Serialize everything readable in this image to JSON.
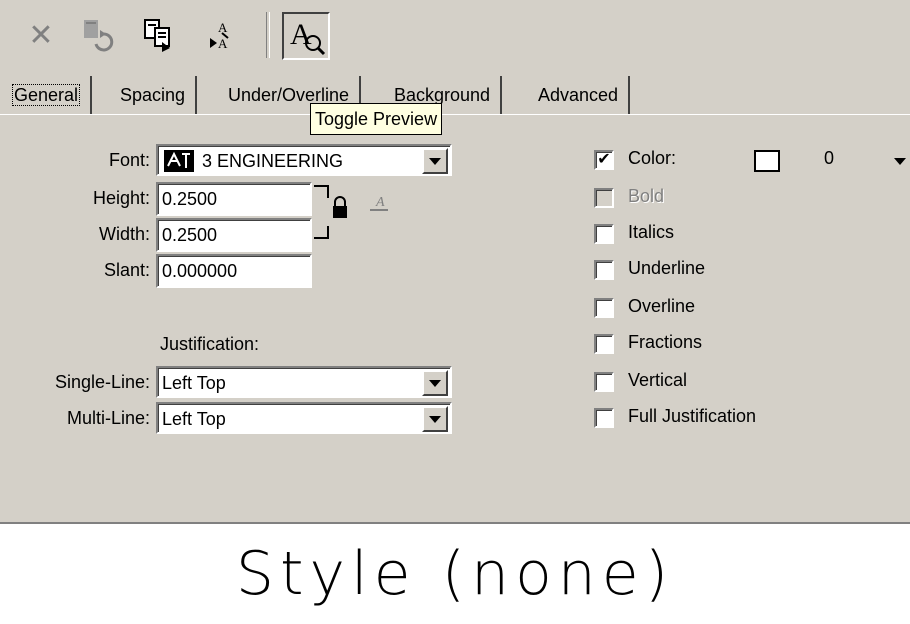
{
  "toolbar": {
    "buttons": [
      {
        "name": "delete-style-icon",
        "glyph": "✕"
      },
      {
        "name": "reset-style-icon",
        "glyph": "↺"
      },
      {
        "name": "copy-style-icon",
        "glyph": "⎘"
      },
      {
        "name": "match-style-icon",
        "glyph": "⇄"
      },
      {
        "name": "toggle-preview-icon",
        "glyph": "A"
      }
    ],
    "tooltip": "Toggle Preview"
  },
  "tabs": [
    "General",
    "Spacing",
    "Under/Overline",
    "Background",
    "Advanced"
  ],
  "fields": {
    "font_label": "Font:",
    "font_value": "3   ENGINEERING",
    "height_label": "Height:",
    "height_value": "0.2500",
    "width_label": "Width:",
    "width_value": "0.2500",
    "slant_label": "Slant:",
    "slant_value": "0.000000",
    "justification_label": "Justification:",
    "single_line_label": "Single-Line:",
    "single_line_value": "Left Top",
    "multi_line_label": "Multi-Line:",
    "multi_line_value": "Left Top"
  },
  "options": {
    "color_label": "Color:",
    "color_value": "0",
    "bold_label": "Bold",
    "italics_label": "Italics",
    "underline_label": "Underline",
    "overline_label": "Overline",
    "fractions_label": "Fractions",
    "vertical_label": "Vertical",
    "full_justification_label": "Full Justification",
    "checked": {
      "color": true,
      "bold": false,
      "italics": false,
      "underline": false,
      "overline": false,
      "fractions": false,
      "vertical": false,
      "full_justification": false
    }
  },
  "preview": {
    "text": "Style (none)"
  }
}
